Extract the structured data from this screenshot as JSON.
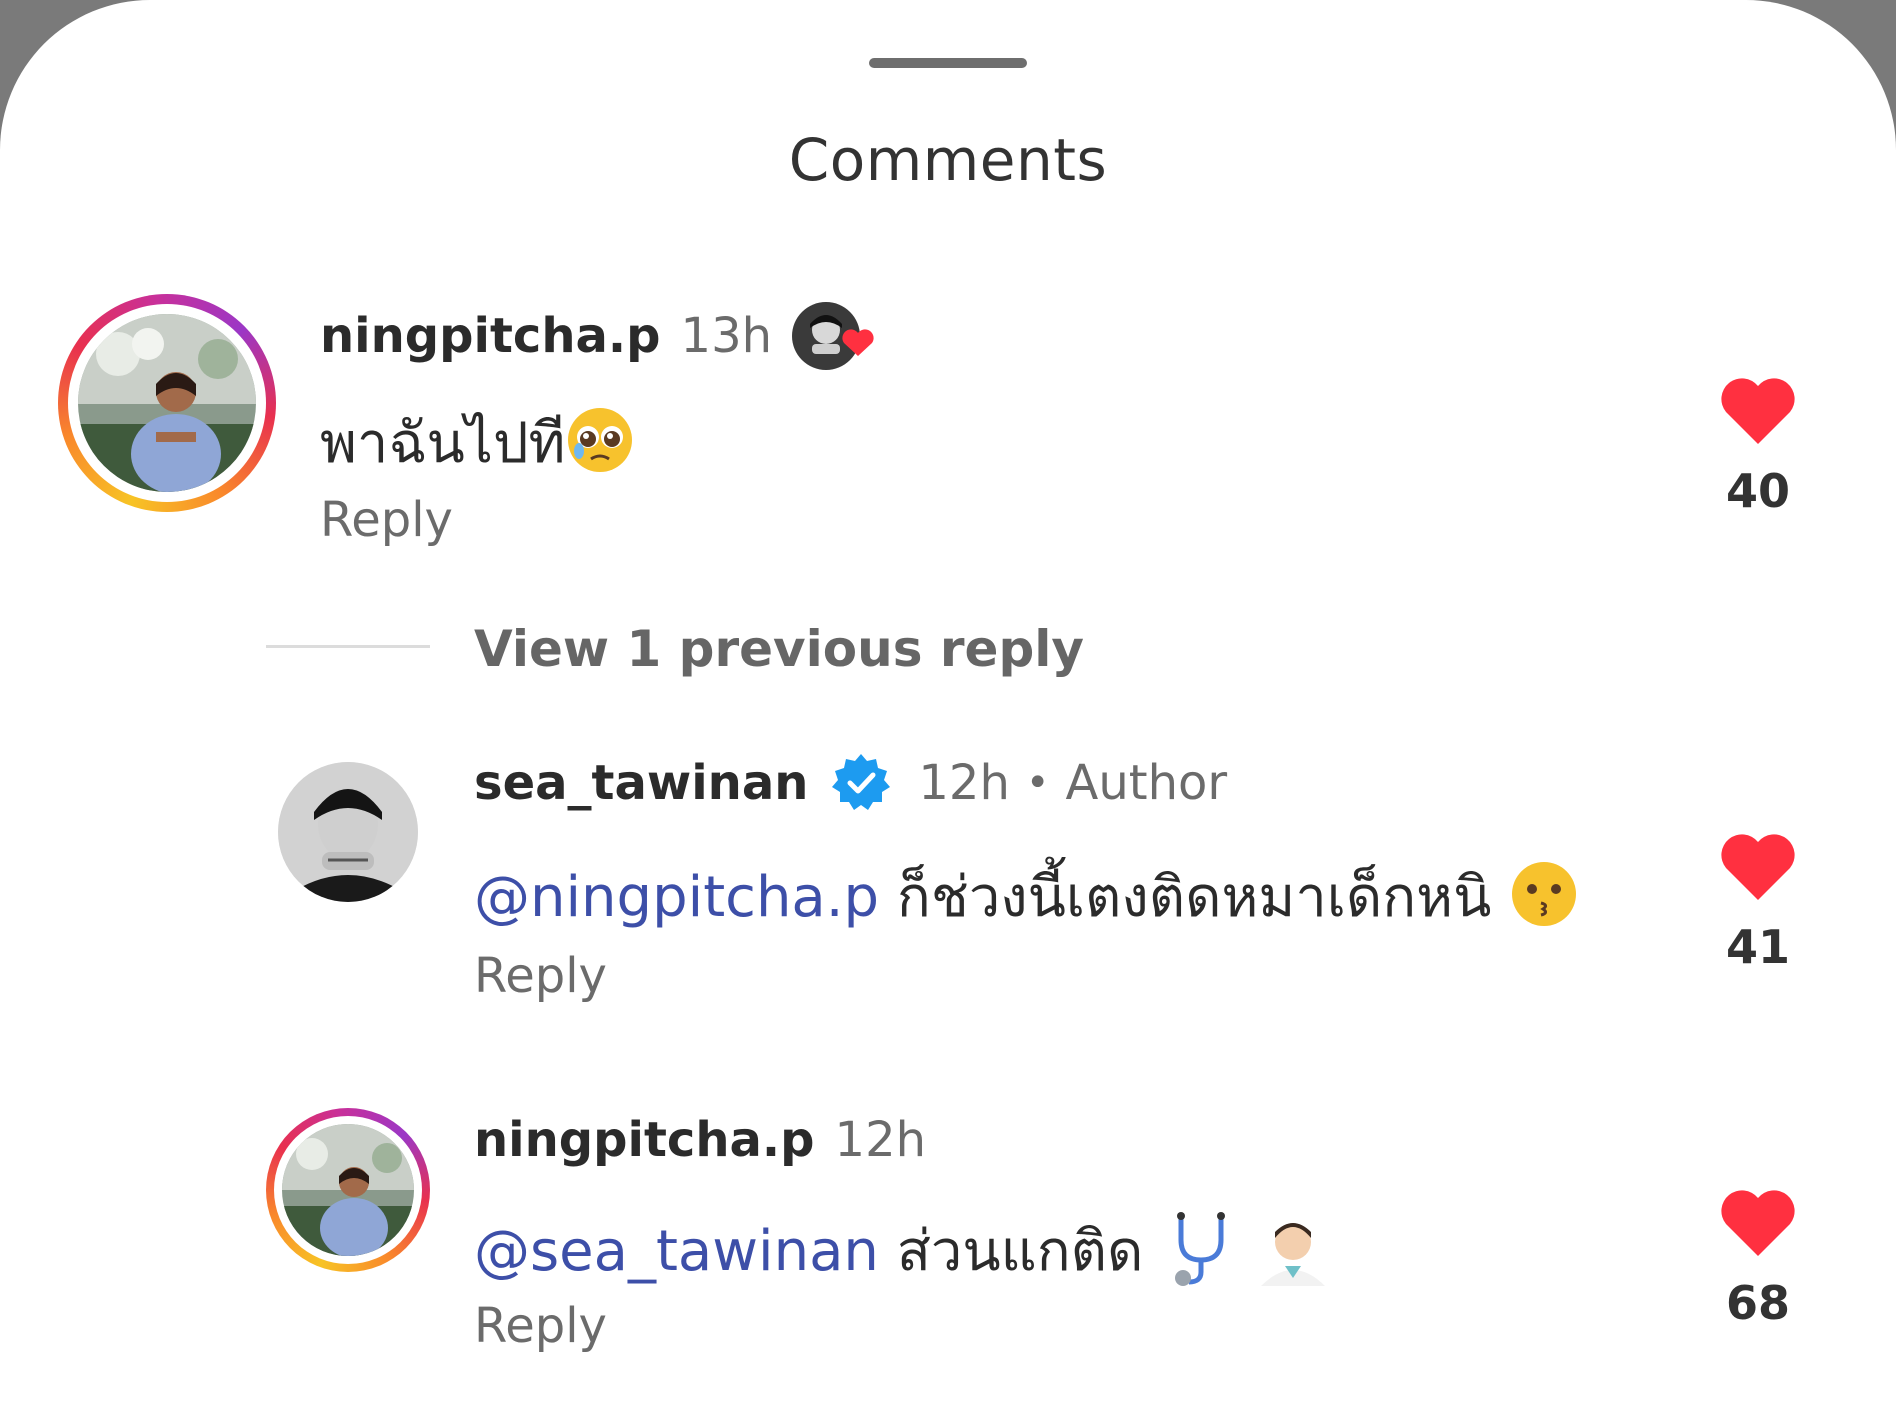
{
  "sheet": {
    "title": "Comments"
  },
  "thread": {
    "view_replies_label": "View 1 previous reply"
  },
  "comments": [
    {
      "username": "ningpitcha.p",
      "time": "13h",
      "text": "พาฉันไปที",
      "reply_label": "Reply",
      "like_count": "40",
      "liked": true,
      "emoji": "pleading-face-emoji",
      "author_liked_badge": true
    },
    {
      "username": "sea_tawinan",
      "verified": true,
      "time": "12h",
      "separator": "•",
      "role": "Author",
      "mention": "@ningpitcha.p",
      "text": "ก็ช่วงนี้เตงติดหมาเด็กหนิ",
      "reply_label": "Reply",
      "like_count": "41",
      "liked": true,
      "emoji": "kissing-face-emoji"
    },
    {
      "username": "ningpitcha.p",
      "time": "12h",
      "mention": "@sea_tawinan",
      "text": "ส่วนแกติด",
      "reply_label": "Reply",
      "like_count": "68",
      "liked": true,
      "emoji": "stethoscope-doctor-emoji"
    }
  ],
  "colors": {
    "heart": "#ff3040",
    "mention": "#3d4fa8",
    "verified": "#1d9bf0"
  }
}
